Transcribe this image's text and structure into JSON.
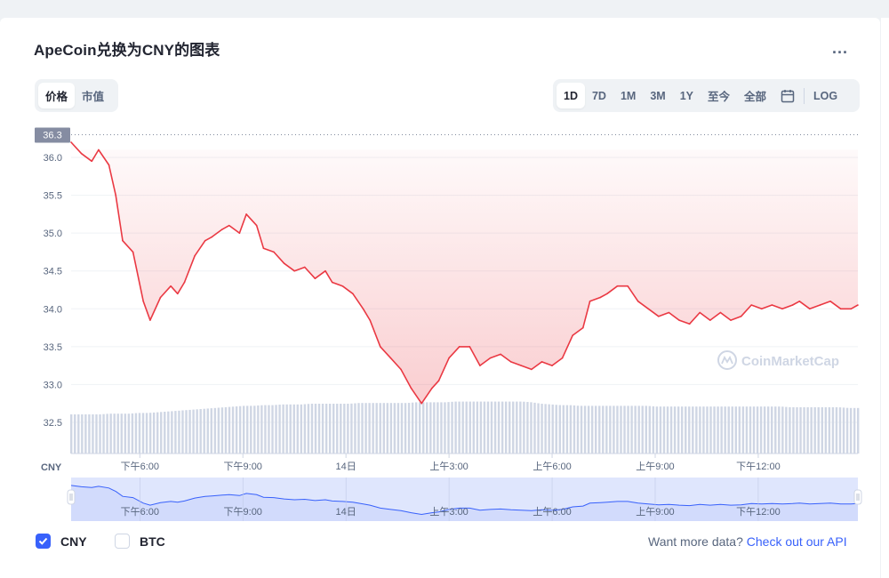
{
  "title": "ApeCoin兑换为CNY的图表",
  "more_label": "...",
  "metric_tabs": [
    {
      "label": "价格",
      "active": true
    },
    {
      "label": "市值",
      "active": false
    }
  ],
  "range_tabs": [
    {
      "label": "1D",
      "active": true
    },
    {
      "label": "7D",
      "active": false
    },
    {
      "label": "1M",
      "active": false
    },
    {
      "label": "3M",
      "active": false
    },
    {
      "label": "1Y",
      "active": false
    },
    {
      "label": "至今",
      "active": false
    },
    {
      "label": "全部",
      "active": false
    }
  ],
  "calendar_icon": "calendar-icon",
  "log_label": "LOG",
  "watermark": "CoinMarketCap",
  "legend": {
    "cny": {
      "label": "CNY",
      "checked": true
    },
    "btc": {
      "label": "BTC",
      "checked": false
    }
  },
  "more_data": {
    "prefix": "Want more data?",
    "link": "Check out our API"
  },
  "colors": {
    "line": "#ea3943",
    "area": "#ea3943",
    "volume": "#cfd6e4",
    "navigator_line": "#3861fb",
    "navigator_fill": "#dfe6fd",
    "accent": "#3861fb"
  },
  "chart_data": {
    "type": "line",
    "currency_label": "CNY",
    "current_value_label": "36.3",
    "ylim": [
      32.5,
      36.3
    ],
    "yticks": [
      "36.0",
      "35.5",
      "35.0",
      "34.5",
      "34.0",
      "33.5",
      "33.0",
      "32.5"
    ],
    "ytick_values": [
      36.0,
      35.5,
      35.0,
      34.5,
      34.0,
      33.5,
      33.0,
      32.5
    ],
    "xticks": [
      "下午6:00",
      "下午9:00",
      "14日",
      "上午3:00",
      "上午6:00",
      "上午9:00",
      "下午12:00"
    ],
    "xtick_hours": [
      2,
      5,
      8,
      11,
      14,
      17,
      20
    ],
    "x_hours": [
      0,
      0.3,
      0.6,
      0.8,
      1.1,
      1.3,
      1.5,
      1.8,
      2.1,
      2.3,
      2.6,
      2.9,
      3.1,
      3.3,
      3.6,
      3.9,
      4.1,
      4.4,
      4.6,
      4.9,
      5.1,
      5.4,
      5.6,
      5.9,
      6.2,
      6.5,
      6.8,
      7.1,
      7.4,
      7.6,
      7.9,
      8.2,
      8.5,
      8.7,
      9.0,
      9.3,
      9.6,
      9.9,
      10.2,
      10.5,
      10.7,
      11.0,
      11.3,
      11.6,
      11.9,
      12.2,
      12.5,
      12.8,
      13.1,
      13.4,
      13.7,
      14.0,
      14.3,
      14.6,
      14.9,
      15.1,
      15.4,
      15.6,
      15.9,
      16.2,
      16.5,
      16.8,
      17.1,
      17.4,
      17.7,
      18.0,
      18.3,
      18.6,
      18.9,
      19.2,
      19.5,
      19.8,
      20.1,
      20.4,
      20.7,
      21.0,
      21.2,
      21.5,
      21.8,
      22.1,
      22.4,
      22.7,
      22.9
    ],
    "values": [
      36.2,
      36.05,
      35.95,
      36.1,
      35.9,
      35.5,
      34.9,
      34.75,
      34.1,
      33.85,
      34.15,
      34.3,
      34.2,
      34.35,
      34.7,
      34.9,
      34.95,
      35.05,
      35.1,
      35.0,
      35.25,
      35.1,
      34.8,
      34.75,
      34.6,
      34.5,
      34.55,
      34.4,
      34.5,
      34.35,
      34.3,
      34.2,
      34.0,
      33.85,
      33.5,
      33.35,
      33.2,
      32.95,
      32.75,
      32.95,
      33.05,
      33.35,
      33.5,
      33.5,
      33.25,
      33.35,
      33.4,
      33.3,
      33.25,
      33.2,
      33.3,
      33.25,
      33.35,
      33.65,
      33.75,
      34.1,
      34.15,
      34.2,
      34.3,
      34.3,
      34.1,
      34.0,
      33.9,
      33.95,
      33.85,
      33.8,
      33.95,
      33.85,
      33.95,
      33.85,
      33.9,
      34.05,
      34.0,
      34.05,
      34.0,
      34.05,
      34.1,
      34.0,
      34.05,
      34.1,
      34.0,
      34.0,
      34.05
    ],
    "volume": [
      0.55,
      0.55,
      0.55,
      0.55,
      0.56,
      0.56,
      0.56,
      0.57,
      0.57,
      0.58,
      0.59,
      0.6,
      0.61,
      0.62,
      0.63,
      0.64,
      0.65,
      0.66,
      0.67,
      0.67,
      0.68,
      0.68,
      0.69,
      0.69,
      0.69,
      0.7,
      0.7,
      0.7,
      0.7,
      0.7,
      0.71,
      0.71,
      0.71,
      0.71,
      0.71,
      0.71,
      0.72,
      0.72,
      0.72,
      0.72,
      0.73,
      0.73,
      0.73,
      0.73,
      0.73,
      0.73,
      0.73,
      0.73,
      0.72,
      0.7,
      0.69,
      0.68,
      0.68,
      0.67,
      0.67,
      0.67,
      0.67,
      0.67,
      0.67,
      0.67,
      0.67,
      0.66,
      0.66,
      0.66,
      0.66,
      0.66,
      0.66,
      0.66,
      0.66,
      0.66,
      0.66,
      0.66,
      0.66,
      0.66,
      0.66,
      0.65,
      0.65,
      0.65,
      0.65,
      0.65,
      0.65,
      0.64,
      0.64
    ],
    "navigator": {
      "xticks": [
        "下午6:00",
        "下午9:00",
        "14日",
        "上午3:00",
        "上午6:00",
        "上午9:00",
        "下午12:00"
      ]
    }
  }
}
